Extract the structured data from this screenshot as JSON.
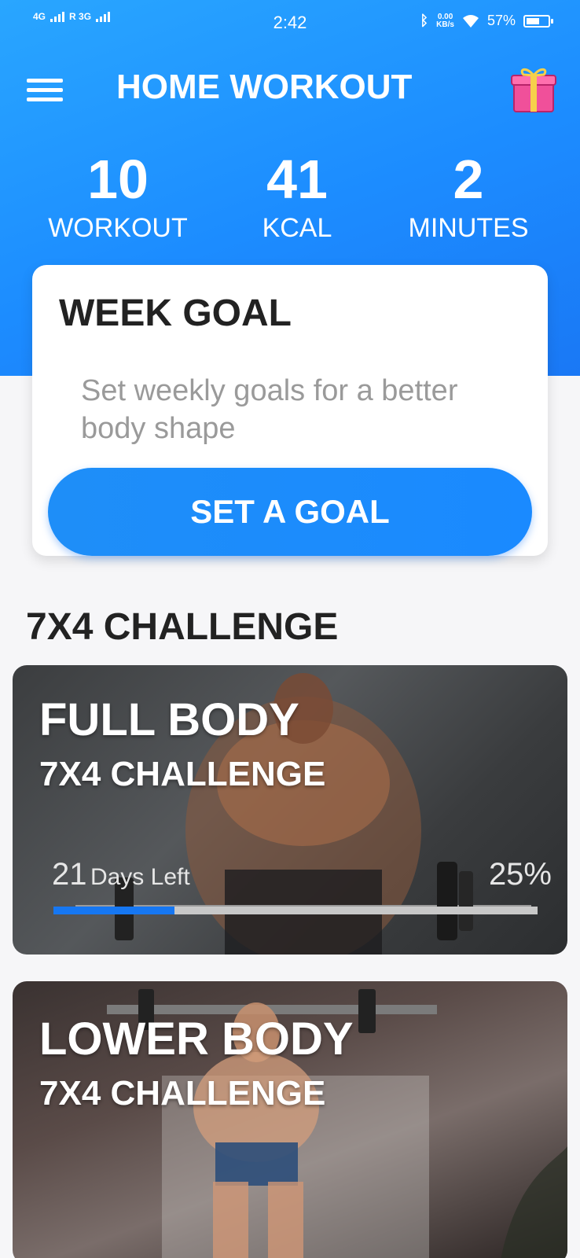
{
  "status_bar": {
    "network_left": "4G",
    "network_right": "R 3G",
    "time": "2:42",
    "speed_value": "0.00",
    "speed_unit": "KB/s",
    "battery": "57%"
  },
  "header": {
    "title": "HOME WORKOUT",
    "menu_icon": "hamburger-menu-icon",
    "gift_icon": "gift-icon"
  },
  "stats": [
    {
      "value": "10",
      "label": "WORKOUT"
    },
    {
      "value": "41",
      "label": "KCAL"
    },
    {
      "value": "2",
      "label": "MINUTES"
    }
  ],
  "week_goal": {
    "title": "WEEK GOAL",
    "description": "Set weekly goals for a better body shape",
    "button_label": "SET A GOAL"
  },
  "section": {
    "title": "7X4 CHALLENGE"
  },
  "challenges": [
    {
      "name": "FULL BODY",
      "subtitle": "7X4 CHALLENGE",
      "days_left_number": "21",
      "days_left_text": "Days Left",
      "percent": "25%",
      "progress": 0.25
    },
    {
      "name": "LOWER BODY",
      "subtitle": "7X4 CHALLENGE"
    }
  ],
  "colors": {
    "primary": "#1C8CFF",
    "progress_fill": "#1677F2",
    "gift_pink": "#F0509A",
    "gift_ribbon": "#F6D04B"
  }
}
